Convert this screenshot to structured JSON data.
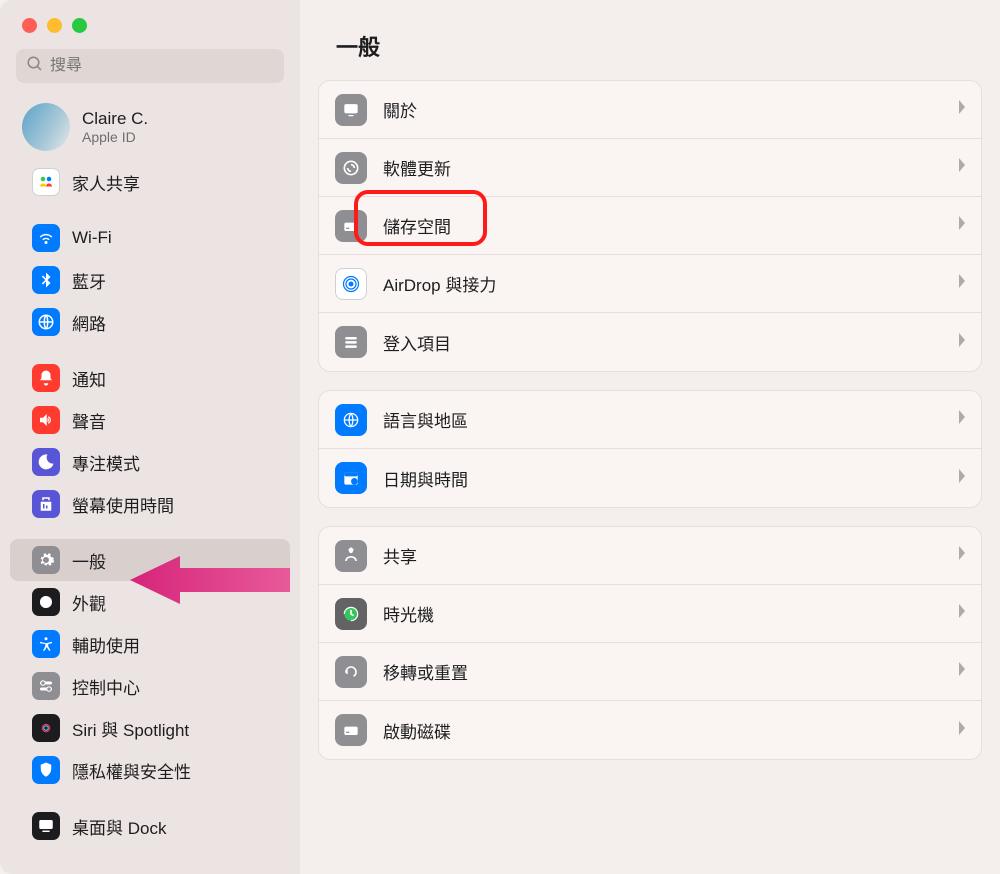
{
  "search": {
    "placeholder": "搜尋"
  },
  "account": {
    "name": "Claire C.",
    "sub": "Apple ID"
  },
  "sidebar": {
    "family": "家人共享",
    "wifi": "Wi-Fi",
    "bluetooth": "藍牙",
    "network": "網路",
    "notifications": "通知",
    "sound": "聲音",
    "focus": "專注模式",
    "screentime": "螢幕使用時間",
    "general": "一般",
    "appearance": "外觀",
    "accessibility": "輔助使用",
    "controlcenter": "控制中心",
    "siri": "Siri 與 Spotlight",
    "privacy": "隱私權與安全性",
    "desktop": "桌面與 Dock"
  },
  "main": {
    "title": "一般",
    "about": "關於",
    "update": "軟體更新",
    "storage": "儲存空間",
    "airdrop": "AirDrop 與接力",
    "login": "登入項目",
    "language": "語言與地區",
    "datetime": "日期與時間",
    "sharing": "共享",
    "timemachine": "時光機",
    "transfer": "移轉或重置",
    "startup": "啟動磁碟"
  }
}
